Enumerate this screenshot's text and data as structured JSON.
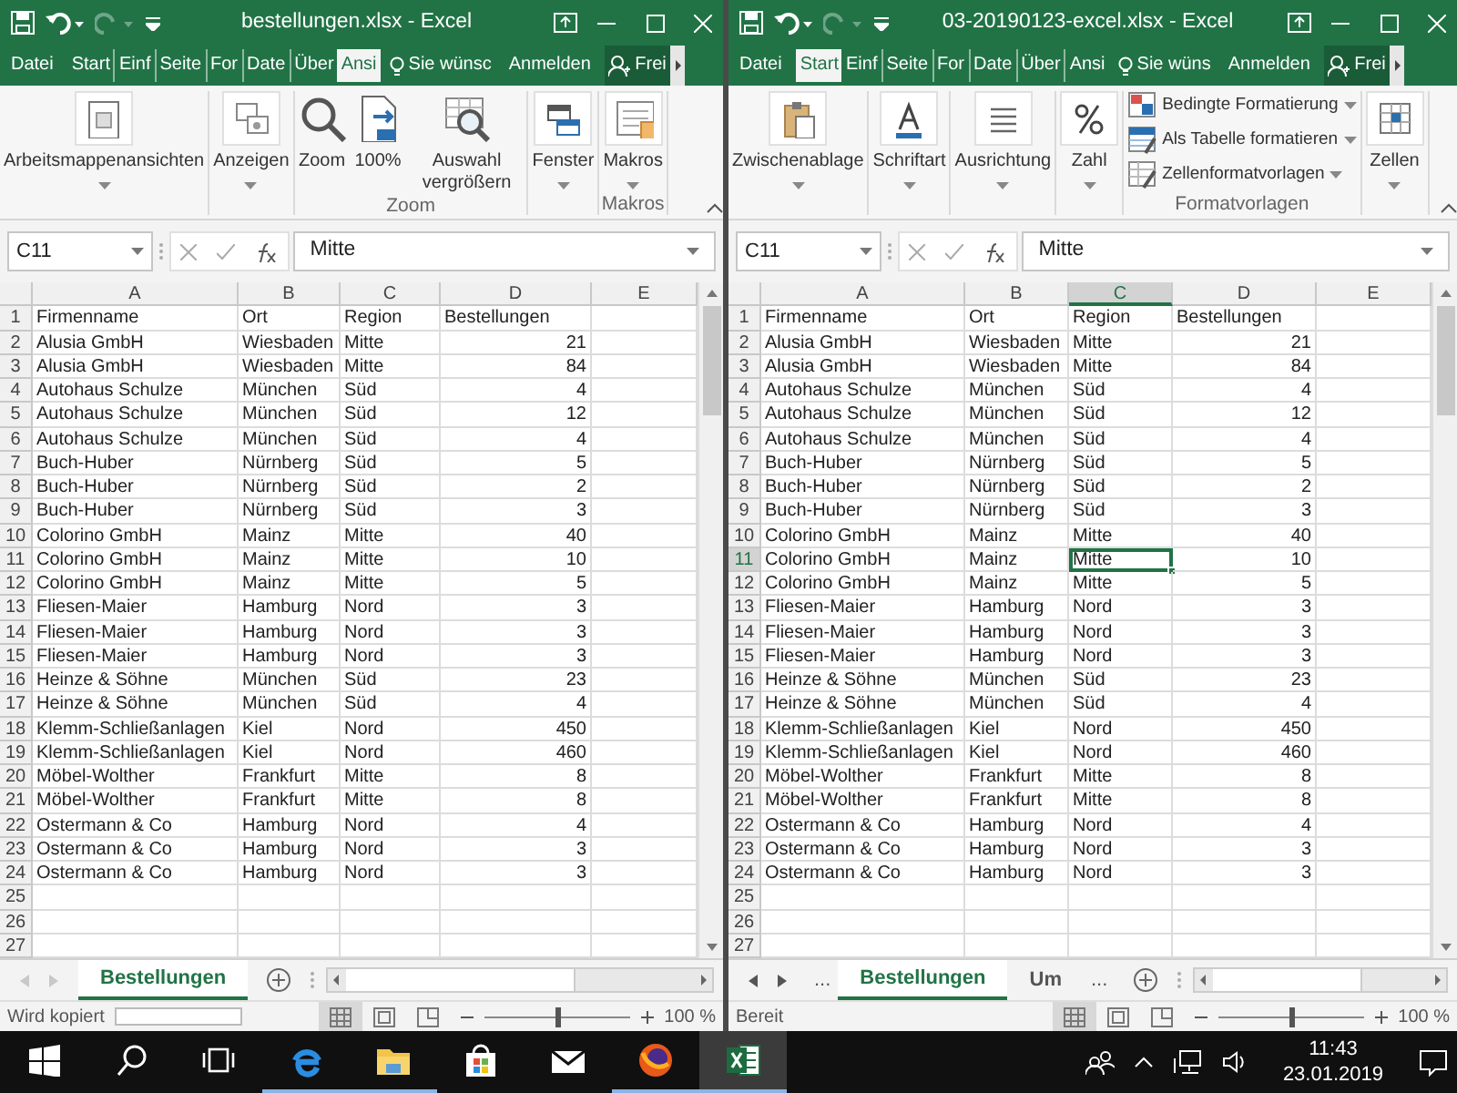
{
  "windows": [
    {
      "title": "bestellungen.xlsx - Excel",
      "tabs": [
        {
          "label": "Datei",
          "selected": false
        },
        {
          "label": "Start",
          "selected": false
        },
        {
          "label": "Einf",
          "selected": false
        },
        {
          "label": "Seite",
          "selected": false
        },
        {
          "label": "For",
          "selected": false
        },
        {
          "label": "Date",
          "selected": false
        },
        {
          "label": "Über",
          "selected": false
        },
        {
          "label": "Ansi",
          "selected": true
        }
      ],
      "tell_me": "Sie wünsc",
      "sign_in": "Anmelden",
      "share": "Frei",
      "ribbon": [
        {
          "items": [
            {
              "kind": "collapsed",
              "label": "Arbeitsmappenansichten",
              "dropdown": true
            }
          ]
        },
        {
          "items": [
            {
              "kind": "collapsed",
              "label": "Anzeigen",
              "dropdown": true
            }
          ]
        },
        {
          "label": "Zoom",
          "items": [
            {
              "kind": "large",
              "label": "Zoom",
              "dropdown": false
            },
            {
              "kind": "large",
              "label": "100%",
              "dropdown": false
            },
            {
              "kind": "large",
              "label": "Auswahl vergrößern",
              "dropdown": false
            }
          ]
        },
        {
          "items": [
            {
              "kind": "collapsed",
              "label": "Fenster",
              "dropdown": true
            }
          ]
        },
        {
          "label": "Makros",
          "items": [
            {
              "kind": "collapsed",
              "label": "Makros",
              "dropdown": true
            }
          ]
        }
      ],
      "name_box": "C11",
      "formula": "Mitte",
      "grid": {
        "columns": [
          {
            "label": "A",
            "selected": false,
            "kind": "text"
          },
          {
            "label": "B",
            "selected": false,
            "kind": "text"
          },
          {
            "label": "C",
            "selected": false,
            "kind": "text"
          },
          {
            "label": "D",
            "selected": false,
            "kind": "number"
          },
          {
            "label": "E",
            "selected": false,
            "kind": "text"
          }
        ],
        "rows": [
          {
            "number": "1",
            "selected": false,
            "kind": "header",
            "cells": [
              "Firmenname",
              "Ort",
              "Region",
              "Bestellungen"
            ]
          },
          {
            "number": "2",
            "selected": false,
            "kind": "data",
            "cells": [
              "Alusia GmbH",
              "Wiesbaden",
              "Mitte",
              "21"
            ]
          },
          {
            "number": "3",
            "selected": false,
            "kind": "data",
            "cells": [
              "Alusia GmbH",
              "Wiesbaden",
              "Mitte",
              "84"
            ]
          },
          {
            "number": "4",
            "selected": false,
            "kind": "data",
            "cells": [
              "Autohaus Schulze",
              "München",
              "Süd",
              "4"
            ]
          },
          {
            "number": "5",
            "selected": false,
            "kind": "data",
            "cells": [
              "Autohaus Schulze",
              "München",
              "Süd",
              "12"
            ]
          },
          {
            "number": "6",
            "selected": false,
            "kind": "data",
            "cells": [
              "Autohaus Schulze",
              "München",
              "Süd",
              "4"
            ]
          },
          {
            "number": "7",
            "selected": false,
            "kind": "data",
            "cells": [
              "Buch-Huber",
              "Nürnberg",
              "Süd",
              "5"
            ]
          },
          {
            "number": "8",
            "selected": false,
            "kind": "data",
            "cells": [
              "Buch-Huber",
              "Nürnberg",
              "Süd",
              "2"
            ]
          },
          {
            "number": "9",
            "selected": false,
            "kind": "data",
            "cells": [
              "Buch-Huber",
              "Nürnberg",
              "Süd",
              "3"
            ]
          },
          {
            "number": "10",
            "selected": false,
            "kind": "data",
            "cells": [
              "Colorino GmbH",
              "Mainz",
              "Mitte",
              "40"
            ]
          },
          {
            "number": "11",
            "selected": false,
            "kind": "data",
            "cells": [
              "Colorino GmbH",
              "Mainz",
              "Mitte",
              "10"
            ]
          },
          {
            "number": "12",
            "selected": false,
            "kind": "data",
            "cells": [
              "Colorino GmbH",
              "Mainz",
              "Mitte",
              "5"
            ]
          },
          {
            "number": "13",
            "selected": false,
            "kind": "data",
            "cells": [
              "Fliesen-Maier",
              "Hamburg",
              "Nord",
              "3"
            ]
          },
          {
            "number": "14",
            "selected": false,
            "kind": "data",
            "cells": [
              "Fliesen-Maier",
              "Hamburg",
              "Nord",
              "3"
            ]
          },
          {
            "number": "15",
            "selected": false,
            "kind": "data",
            "cells": [
              "Fliesen-Maier",
              "Hamburg",
              "Nord",
              "3"
            ]
          },
          {
            "number": "16",
            "selected": false,
            "kind": "data",
            "cells": [
              "Heinze & Söhne",
              "München",
              "Süd",
              "23"
            ]
          },
          {
            "number": "17",
            "selected": false,
            "kind": "data",
            "cells": [
              "Heinze & Söhne",
              "München",
              "Süd",
              "4"
            ]
          },
          {
            "number": "18",
            "selected": false,
            "kind": "data",
            "cells": [
              "Klemm-Schließanlagen",
              "Kiel",
              "Nord",
              "450"
            ]
          },
          {
            "number": "19",
            "selected": false,
            "kind": "data",
            "cells": [
              "Klemm-Schließanlagen",
              "Kiel",
              "Nord",
              "460"
            ]
          },
          {
            "number": "20",
            "selected": false,
            "kind": "data",
            "cells": [
              "Möbel-Wolther",
              "Frankfurt",
              "Mitte",
              "8"
            ]
          },
          {
            "number": "21",
            "selected": false,
            "kind": "data",
            "cells": [
              "Möbel-Wolther",
              "Frankfurt",
              "Mitte",
              "8"
            ]
          },
          {
            "number": "22",
            "selected": false,
            "kind": "data",
            "cells": [
              "Ostermann & Co",
              "Hamburg",
              "Nord",
              "4"
            ]
          },
          {
            "number": "23",
            "selected": false,
            "kind": "data",
            "cells": [
              "Ostermann & Co",
              "Hamburg",
              "Nord",
              "3"
            ]
          },
          {
            "number": "24",
            "selected": false,
            "kind": "data",
            "cells": [
              "Ostermann & Co",
              "Hamburg",
              "Nord",
              "3"
            ]
          },
          {
            "number": "25",
            "selected": false,
            "kind": "data"
          },
          {
            "number": "26",
            "selected": false,
            "kind": "data"
          },
          {
            "number": "27",
            "selected": false,
            "kind": "data"
          }
        ]
      },
      "sheet_bar": {
        "nav_disabled": true,
        "items": [
          {
            "kind": "sheet",
            "label": "Bestellungen",
            "selected": true
          }
        ]
      },
      "status_bar": {
        "text": "Wird kopiert",
        "progress": {
          "level": 0
        },
        "views": [
          {
            "selected": true
          },
          {
            "selected": false
          },
          {
            "selected": false
          }
        ],
        "zoom": {
          "level": 0.5
        },
        "zoom_text": "100 %"
      }
    },
    {
      "title": "03-20190123-excel.xlsx - Excel",
      "tabs": [
        {
          "label": "Datei",
          "selected": false
        },
        {
          "label": "Start",
          "selected": true
        },
        {
          "label": "Einf",
          "selected": false
        },
        {
          "label": "Seite",
          "selected": false
        },
        {
          "label": "For",
          "selected": false
        },
        {
          "label": "Date",
          "selected": false
        },
        {
          "label": "Über",
          "selected": false
        },
        {
          "label": "Ansi",
          "selected": false
        }
      ],
      "tell_me": "Sie wüns",
      "sign_in": "Anmelden",
      "share": "Frei",
      "ribbon": [
        {
          "items": [
            {
              "kind": "collapsed",
              "label": "Zwischenablage",
              "dropdown": true
            }
          ]
        },
        {
          "items": [
            {
              "kind": "collapsed",
              "label": "Schriftart",
              "dropdown": true
            }
          ]
        },
        {
          "items": [
            {
              "kind": "collapsed",
              "label": "Ausrichtung",
              "dropdown": true
            }
          ]
        },
        {
          "items": [
            {
              "kind": "collapsed",
              "label": "Zahl",
              "dropdown": true
            }
          ]
        },
        {
          "label": "Formatvorlagen",
          "items": [
            {
              "kind": "small",
              "label": "Bedingte Formatierung",
              "dropdown": true
            },
            {
              "kind": "small",
              "label": "Als Tabelle formatieren",
              "dropdown": true
            },
            {
              "kind": "small",
              "label": "Zellenformatvorlagen",
              "dropdown": true
            }
          ]
        },
        {
          "items": [
            {
              "kind": "collapsed",
              "label": "Zellen",
              "dropdown": true
            }
          ]
        }
      ],
      "name_box": "C11",
      "formula": "Mitte",
      "grid": {
        "columns": [
          {
            "label": "A",
            "selected": false,
            "kind": "text"
          },
          {
            "label": "B",
            "selected": false,
            "kind": "text"
          },
          {
            "label": "C",
            "selected": true,
            "kind": "text"
          },
          {
            "label": "D",
            "selected": false,
            "kind": "number"
          },
          {
            "label": "E",
            "selected": false,
            "kind": "text"
          }
        ],
        "rows": [
          {
            "number": "1",
            "selected": false,
            "kind": "header",
            "cells": [
              "Firmenname",
              "Ort",
              "Region",
              "Bestellungen"
            ]
          },
          {
            "number": "2",
            "selected": false,
            "kind": "data",
            "cells": [
              "Alusia GmbH",
              "Wiesbaden",
              "Mitte",
              "21"
            ]
          },
          {
            "number": "3",
            "selected": false,
            "kind": "data",
            "cells": [
              "Alusia GmbH",
              "Wiesbaden",
              "Mitte",
              "84"
            ]
          },
          {
            "number": "4",
            "selected": false,
            "kind": "data",
            "cells": [
              "Autohaus Schulze",
              "München",
              "Süd",
              "4"
            ]
          },
          {
            "number": "5",
            "selected": false,
            "kind": "data",
            "cells": [
              "Autohaus Schulze",
              "München",
              "Süd",
              "12"
            ]
          },
          {
            "number": "6",
            "selected": false,
            "kind": "data",
            "cells": [
              "Autohaus Schulze",
              "München",
              "Süd",
              "4"
            ]
          },
          {
            "number": "7",
            "selected": false,
            "kind": "data",
            "cells": [
              "Buch-Huber",
              "Nürnberg",
              "Süd",
              "5"
            ]
          },
          {
            "number": "8",
            "selected": false,
            "kind": "data",
            "cells": [
              "Buch-Huber",
              "Nürnberg",
              "Süd",
              "2"
            ]
          },
          {
            "number": "9",
            "selected": false,
            "kind": "data",
            "cells": [
              "Buch-Huber",
              "Nürnberg",
              "Süd",
              "3"
            ]
          },
          {
            "number": "10",
            "selected": false,
            "kind": "data",
            "cells": [
              "Colorino GmbH",
              "Mainz",
              "Mitte",
              "40"
            ]
          },
          {
            "number": "11",
            "selected": true,
            "kind": "data",
            "cells": [
              "Colorino GmbH",
              "Mainz",
              "Mitte",
              "10"
            ]
          },
          {
            "number": "12",
            "selected": false,
            "kind": "data",
            "cells": [
              "Colorino GmbH",
              "Mainz",
              "Mitte",
              "5"
            ]
          },
          {
            "number": "13",
            "selected": false,
            "kind": "data",
            "cells": [
              "Fliesen-Maier",
              "Hamburg",
              "Nord",
              "3"
            ]
          },
          {
            "number": "14",
            "selected": false,
            "kind": "data",
            "cells": [
              "Fliesen-Maier",
              "Hamburg",
              "Nord",
              "3"
            ]
          },
          {
            "number": "15",
            "selected": false,
            "kind": "data",
            "cells": [
              "Fliesen-Maier",
              "Hamburg",
              "Nord",
              "3"
            ]
          },
          {
            "number": "16",
            "selected": false,
            "kind": "data",
            "cells": [
              "Heinze & Söhne",
              "München",
              "Süd",
              "23"
            ]
          },
          {
            "number": "17",
            "selected": false,
            "kind": "data",
            "cells": [
              "Heinze & Söhne",
              "München",
              "Süd",
              "4"
            ]
          },
          {
            "number": "18",
            "selected": false,
            "kind": "data",
            "cells": [
              "Klemm-Schließanlagen",
              "Kiel",
              "Nord",
              "450"
            ]
          },
          {
            "number": "19",
            "selected": false,
            "kind": "data",
            "cells": [
              "Klemm-Schließanlagen",
              "Kiel",
              "Nord",
              "460"
            ]
          },
          {
            "number": "20",
            "selected": false,
            "kind": "data",
            "cells": [
              "Möbel-Wolther",
              "Frankfurt",
              "Mitte",
              "8"
            ]
          },
          {
            "number": "21",
            "selected": false,
            "kind": "data",
            "cells": [
              "Möbel-Wolther",
              "Frankfurt",
              "Mitte",
              "8"
            ]
          },
          {
            "number": "22",
            "selected": false,
            "kind": "data",
            "cells": [
              "Ostermann & Co",
              "Hamburg",
              "Nord",
              "4"
            ]
          },
          {
            "number": "23",
            "selected": false,
            "kind": "data",
            "cells": [
              "Ostermann & Co",
              "Hamburg",
              "Nord",
              "3"
            ]
          },
          {
            "number": "24",
            "selected": false,
            "kind": "data",
            "cells": [
              "Ostermann & Co",
              "Hamburg",
              "Nord",
              "3"
            ]
          },
          {
            "number": "25",
            "selected": false,
            "kind": "data"
          },
          {
            "number": "26",
            "selected": false,
            "kind": "data"
          },
          {
            "number": "27",
            "selected": false,
            "kind": "data"
          }
        ]
      },
      "sheet_bar": {
        "nav_disabled": false,
        "items": [
          {
            "kind": "more",
            "label": "...",
            "selected": false
          },
          {
            "kind": "sheet",
            "label": "Bestellungen",
            "selected": true
          },
          {
            "kind": "sheet",
            "label": "Um",
            "selected": false
          },
          {
            "kind": "more",
            "label": "...",
            "selected": false
          }
        ]
      },
      "status_bar": {
        "text": "Bereit",
        "views": [
          {
            "selected": true
          },
          {
            "selected": false
          },
          {
            "selected": false
          }
        ],
        "zoom": {
          "level": 0.5
        },
        "zoom_text": "100 %"
      }
    }
  ],
  "taskbar": {
    "apps": [
      {
        "running": true,
        "selected": false
      },
      {
        "running": true,
        "selected": false
      },
      {
        "running": false,
        "selected": false
      },
      {
        "running": false,
        "selected": false
      },
      {
        "running": true,
        "selected": false
      },
      {
        "running": true,
        "selected": true
      }
    ],
    "time": "11:43",
    "date": "23.01.2019"
  }
}
